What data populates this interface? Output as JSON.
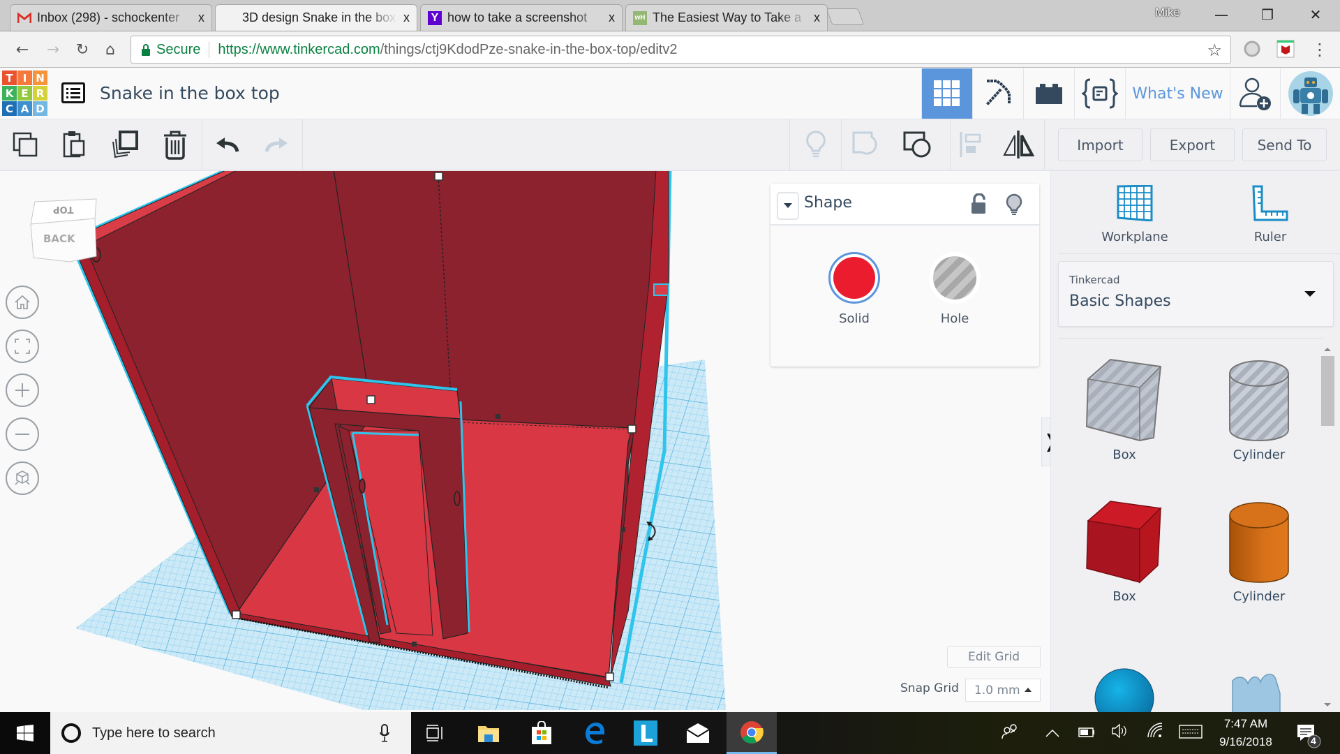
{
  "browser": {
    "tabs": [
      {
        "title": "Inbox (298) - schockenter",
        "icon": "gmail-icon",
        "active": false
      },
      {
        "title": "3D design Snake in the box",
        "icon": "tinkercad-icon",
        "active": true
      },
      {
        "title": "how to take a screenshot",
        "icon": "yahoo-icon",
        "active": false
      },
      {
        "title": "The Easiest Way to Take a",
        "icon": "wikihow-icon",
        "active": false
      }
    ],
    "close_glyph": "x",
    "profile_name": "Mike",
    "window_controls": {
      "minimize": "—",
      "restore": "❐",
      "close": "✕"
    },
    "nav": {
      "back": "←",
      "forward": "→",
      "reload": "↻",
      "home": "⌂"
    },
    "security_label": "Secure",
    "url_host": "https://www.tinkercad.com",
    "url_path": "/things/ctj9KdodPze-snake-in-the-box-top/editv2",
    "bookmark_glyph": "☆",
    "menu_glyph": "⋮"
  },
  "app": {
    "logo_letters": [
      "T",
      "I",
      "N",
      "K",
      "E",
      "R",
      "C",
      "A",
      "D"
    ],
    "logo_colors": [
      "#e9532e",
      "#f5793a",
      "#f5943a",
      "#3db25a",
      "#93c83e",
      "#d4d23a",
      "#1e6fb5",
      "#3d8fd0",
      "#72b8e2"
    ],
    "design_title": "Snake in the box top",
    "header_nav": [
      {
        "name": "3d-design-view",
        "icon": "grid-icon",
        "active": true
      },
      {
        "name": "blocks-view",
        "icon": "pickaxe-icon",
        "active": false
      },
      {
        "name": "bricks-view",
        "icon": "brick-icon",
        "active": false
      },
      {
        "name": "codeblocks-view",
        "icon": "code-braces-icon",
        "active": false
      }
    ],
    "whats_new": "What's New",
    "accent_color": "#5b96dc"
  },
  "toolbar": {
    "left": [
      {
        "name": "copy",
        "icon": "copy-icon",
        "enabled": true
      },
      {
        "name": "paste",
        "icon": "paste-icon",
        "enabled": true
      },
      {
        "name": "duplicate",
        "icon": "duplicate-icon",
        "enabled": true
      },
      {
        "name": "delete",
        "icon": "trash-icon",
        "enabled": true
      },
      {
        "name": "undo",
        "icon": "undo-icon",
        "enabled": true
      },
      {
        "name": "redo",
        "icon": "redo-icon",
        "enabled": false
      }
    ],
    "right": [
      {
        "name": "show-all",
        "icon": "lightbulb-icon",
        "enabled": false
      },
      {
        "name": "group",
        "icon": "group-icon",
        "enabled": false
      },
      {
        "name": "ungroup",
        "icon": "ungroup-icon",
        "enabled": true
      },
      {
        "name": "align",
        "icon": "align-icon",
        "enabled": false
      },
      {
        "name": "mirror",
        "icon": "mirror-icon",
        "enabled": true
      }
    ],
    "import_label": "Import",
    "export_label": "Export",
    "send_to_label": "Send To"
  },
  "viewcube": {
    "top": "TOP",
    "back": "BACK"
  },
  "view_controls": [
    "home-view",
    "fit-all",
    "zoom-in",
    "zoom-out",
    "ortho-perspective"
  ],
  "shape_panel": {
    "title": "Shape",
    "solid_label": "Solid",
    "hole_label": "Hole",
    "solid_color": "#ea1c2d",
    "selected": "Solid"
  },
  "right_panel": {
    "workplane_label": "Workplane",
    "ruler_label": "Ruler",
    "library_category": "Tinkercad",
    "library_name": "Basic Shapes",
    "shapes": [
      {
        "label": "Box",
        "kind": "box-hole"
      },
      {
        "label": "Cylinder",
        "kind": "cylinder-hole"
      },
      {
        "label": "Box",
        "kind": "box-solid"
      },
      {
        "label": "Cylinder",
        "kind": "cylinder-solid"
      },
      {
        "label": "",
        "kind": "sphere"
      },
      {
        "label": "",
        "kind": "scribble"
      }
    ]
  },
  "grid": {
    "edit_grid_label": "Edit Grid",
    "snap_grid_label": "Snap Grid",
    "snap_value": "1.0 mm"
  },
  "taskbar": {
    "search_placeholder": "Type here to search",
    "time": "7:47 AM",
    "date": "9/16/2018",
    "notification_count": "4"
  }
}
